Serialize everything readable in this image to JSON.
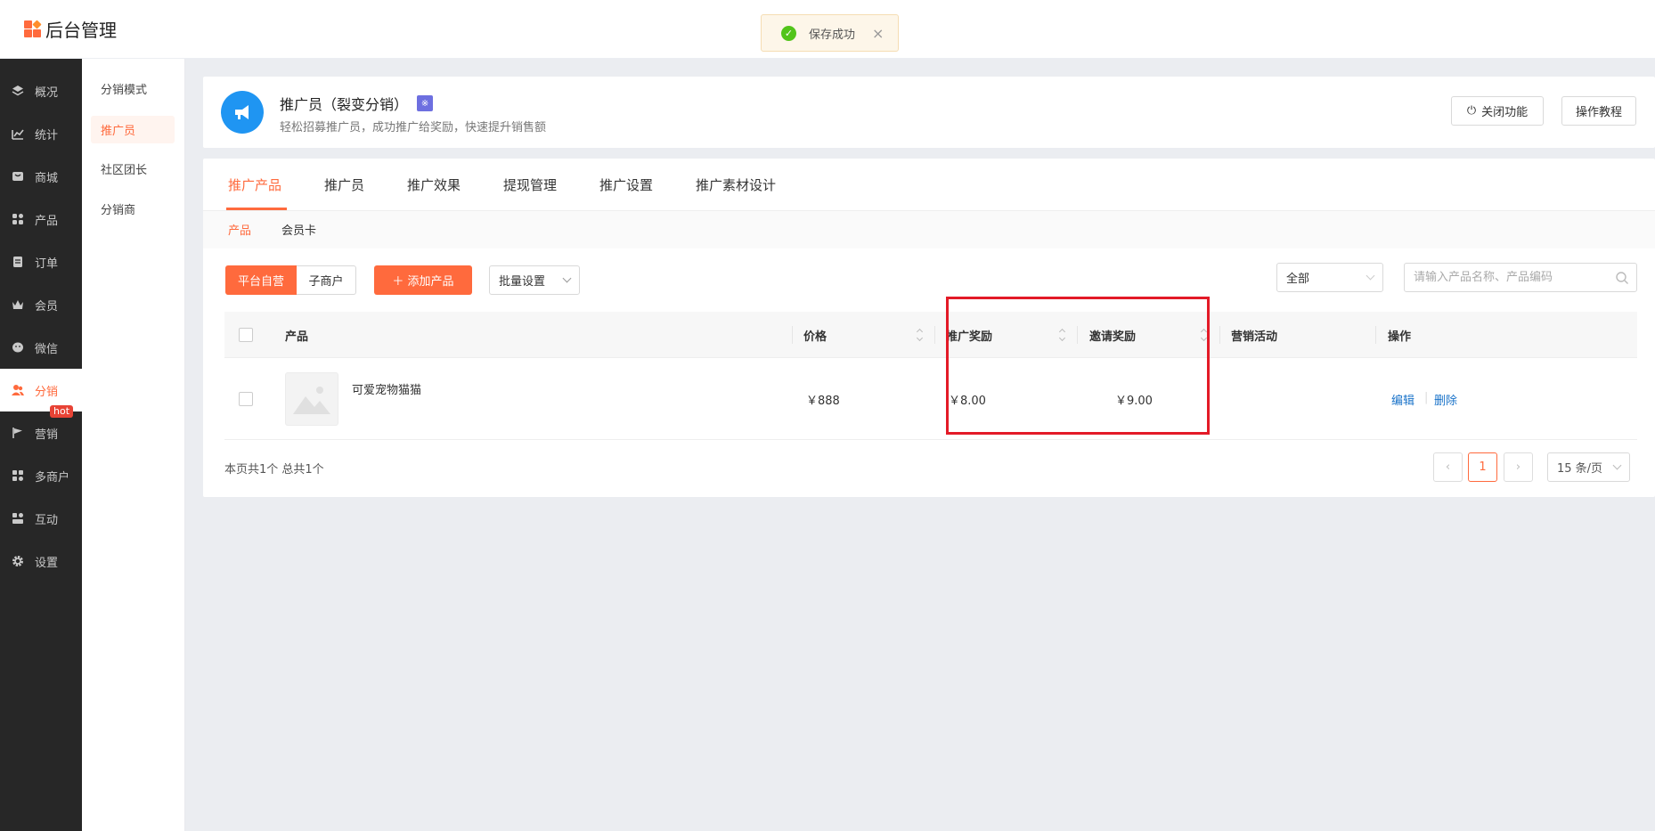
{
  "app": {
    "title": "后台管理"
  },
  "toast": {
    "text": "保存成功"
  },
  "sidebar": {
    "items": [
      {
        "label": "概况",
        "icon": "layers-icon"
      },
      {
        "label": "统计",
        "icon": "chart-icon"
      },
      {
        "label": "商城",
        "icon": "shop-icon"
      },
      {
        "label": "产品",
        "icon": "grid-icon"
      },
      {
        "label": "订单",
        "icon": "order-icon"
      },
      {
        "label": "会员",
        "icon": "crown-icon"
      },
      {
        "label": "微信",
        "icon": "wechat-icon"
      },
      {
        "label": "分销",
        "icon": "users-icon",
        "active": true
      },
      {
        "label": "营销",
        "icon": "flag-icon",
        "badge": "hot"
      },
      {
        "label": "多商户",
        "icon": "store-icon"
      },
      {
        "label": "互动",
        "icon": "interact-icon"
      },
      {
        "label": "设置",
        "icon": "gear-icon"
      }
    ]
  },
  "subsidebar": {
    "items": [
      {
        "label": "分销模式"
      },
      {
        "label": "推广员",
        "active": true
      },
      {
        "label": "社区团长"
      },
      {
        "label": "分销商"
      }
    ]
  },
  "header": {
    "title": "推广员（裂变分销）",
    "badge": "※",
    "desc": "轻松招募推广员，成功推广给奖励，快速提升销售额",
    "close_label": "关闭功能",
    "tutorial_label": "操作教程"
  },
  "tabs": [
    "推广产品",
    "推广员",
    "推广效果",
    "提现管理",
    "推广设置",
    "推广素材设计"
  ],
  "subtabs": [
    "产品",
    "会员卡"
  ],
  "toolbar": {
    "seg_self": "平台自营",
    "seg_sub": "子商户",
    "add_label": "＋ 添加产品",
    "batch_label": "批量设置",
    "filter_value": "全部",
    "search_placeholder": "请输入产品名称、产品编码"
  },
  "table": {
    "headers": {
      "product": "产品",
      "price": "价格",
      "promo": "推广奖励",
      "invite": "邀请奖励",
      "activity": "营销活动",
      "ops": "操作"
    },
    "rows": [
      {
        "name": "可爱宠物猫猫",
        "price": "￥888",
        "promo": "￥8.00",
        "invite": "￥9.00",
        "activity": "",
        "edit": "编辑",
        "delete": "删除"
      }
    ]
  },
  "footer": {
    "summary": "本页共1个 总共1个",
    "page": "1",
    "page_size": "15 条/页"
  },
  "colors": {
    "accent": "#ff6a3d",
    "sidebar": "#272727",
    "highlight": "#e31a27",
    "link": "#1a73c9"
  }
}
